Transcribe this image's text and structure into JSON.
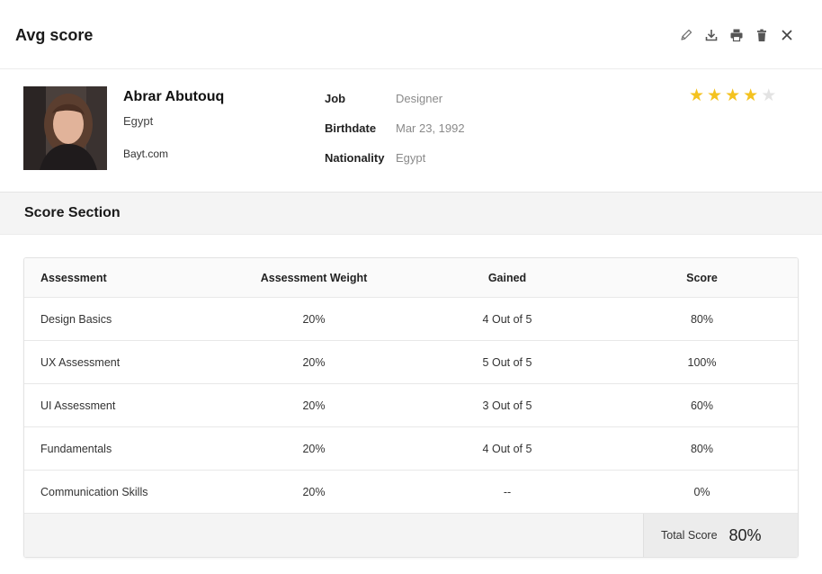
{
  "header": {
    "title": "Avg score",
    "actions": [
      "pencil-icon",
      "download-icon",
      "print-icon",
      "trash-icon",
      "close-icon"
    ]
  },
  "profile": {
    "name": "Abrar Abutouq",
    "country": "Egypt",
    "source": "Bayt.com",
    "details": {
      "job_label": "Job",
      "job_value": "Designer",
      "birthdate_label": "Birthdate",
      "birthdate_value": "Mar 23, 1992",
      "nationality_label": "Nationality",
      "nationality_value": "Egypt"
    },
    "rating": 4,
    "rating_max": 5,
    "star_color": "#f4c21f"
  },
  "section": {
    "title": "Score Section"
  },
  "table": {
    "headers": [
      "Assessment",
      "Assessment Weight",
      "Gained",
      "Score"
    ],
    "rows": [
      [
        "Design Basics",
        "20%",
        "4 Out of 5",
        "80%"
      ],
      [
        "UX Assessment",
        "20%",
        "5 Out of 5",
        "100%"
      ],
      [
        "UI Assessment",
        "20%",
        "3 Out of 5",
        "60%"
      ],
      [
        "Fundamentals",
        "20%",
        "4 Out of 5",
        "80%"
      ],
      [
        "Communication Skills",
        "20%",
        "--",
        "0%"
      ]
    ],
    "total_label": "Total Score",
    "total_value": "80%"
  }
}
